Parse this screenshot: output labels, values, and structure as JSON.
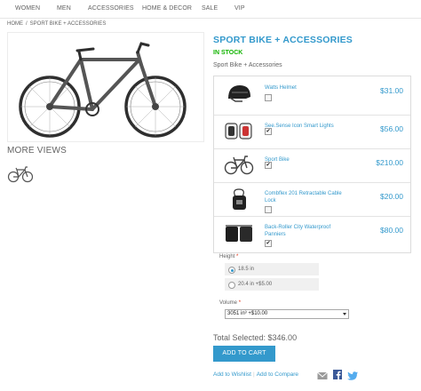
{
  "nav": {
    "items": [
      "WOMEN",
      "MEN",
      "ACCESSORIES",
      "HOME & DECOR",
      "SALE",
      "VIP"
    ]
  },
  "breadcrumb": {
    "home": "HOME",
    "separator": "/",
    "current": "SPORT BIKE + ACCESSORIES"
  },
  "gallery": {
    "more_views": "MORE VIEWS"
  },
  "product": {
    "title": "SPORT BIKE + ACCESSORIES",
    "stock": "IN STOCK",
    "description": "Sport Bike + Accessories"
  },
  "bundle": {
    "items": [
      {
        "name": "Watts Helmet",
        "price": "$31.00",
        "checked": false,
        "icon": "helmet-icon"
      },
      {
        "name": "See.Sense Icon Smart Lights",
        "price": "$56.00",
        "checked": true,
        "icon": "bike-lights-icon"
      },
      {
        "name": "Sport Bike",
        "price": "$210.00",
        "checked": true,
        "icon": "bicycle-icon"
      },
      {
        "name": "Combflex 201 Retractable Cable Lock",
        "price": "$20.00",
        "checked": false,
        "icon": "cable-lock-icon"
      },
      {
        "name": "Back-Roller City Waterproof Panniers",
        "price": "$80.00",
        "checked": true,
        "icon": "panniers-icon"
      }
    ]
  },
  "options": {
    "height_label": "Height",
    "required_mark": "*",
    "height_options": [
      {
        "label": "18.5 in",
        "selected": true
      },
      {
        "label": "20.4 in +$5.00",
        "selected": false
      }
    ],
    "volume_label": "Volume",
    "volume_selected": "3051 in³ +$10.00"
  },
  "summary": {
    "total": "Total Selected: $346.00",
    "add_to_cart": "ADD TO CART",
    "wishlist": "Add to Wishlist",
    "compare": "Add to Compare",
    "pipe": "|"
  },
  "colors": {
    "accent": "#3399cc",
    "stock": "#11b400",
    "text": "#636363",
    "required": "#df280a"
  }
}
